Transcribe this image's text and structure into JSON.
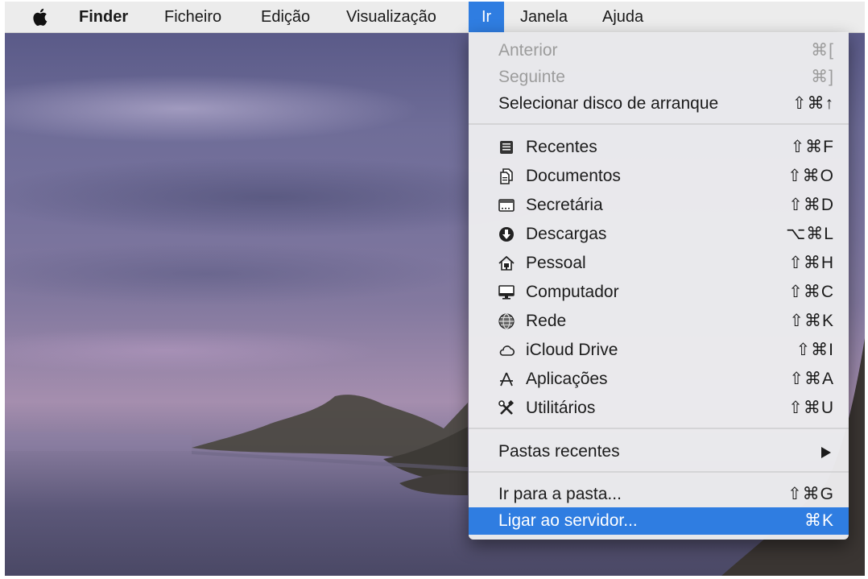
{
  "menubar": {
    "apple_icon": "apple-logo-icon",
    "app_name": "Finder",
    "items": [
      "Ficheiro",
      "Edição",
      "Visualização",
      "Ir",
      "Janela",
      "Ajuda"
    ],
    "active_item": "Ir"
  },
  "go_menu": {
    "navigation": [
      {
        "label": "Anterior",
        "shortcut": "⌘[",
        "enabled": false
      },
      {
        "label": "Seguinte",
        "shortcut": "⌘]",
        "enabled": false
      },
      {
        "label": "Selecionar disco de arranque",
        "shortcut": "⇧⌘↑",
        "enabled": true
      }
    ],
    "places": [
      {
        "label": "Recentes",
        "shortcut": "⇧⌘F",
        "icon": "recents-icon"
      },
      {
        "label": "Documentos",
        "shortcut": "⇧⌘O",
        "icon": "documents-icon"
      },
      {
        "label": "Secretária",
        "shortcut": "⇧⌘D",
        "icon": "desktop-icon"
      },
      {
        "label": "Descargas",
        "shortcut": "⌥⌘L",
        "icon": "downloads-icon"
      },
      {
        "label": "Pessoal",
        "shortcut": "⇧⌘H",
        "icon": "home-icon"
      },
      {
        "label": "Computador",
        "shortcut": "⇧⌘C",
        "icon": "computer-icon"
      },
      {
        "label": "Rede",
        "shortcut": "⇧⌘K",
        "icon": "network-icon"
      },
      {
        "label": "iCloud Drive",
        "shortcut": "⇧⌘I",
        "icon": "icloud-icon"
      },
      {
        "label": "Aplicações",
        "shortcut": "⇧⌘A",
        "icon": "applications-icon"
      },
      {
        "label": "Utilitários",
        "shortcut": "⇧⌘U",
        "icon": "utilities-icon"
      }
    ],
    "recent_folders": {
      "label": "Pastas recentes",
      "has_submenu": true
    },
    "folder_actions": [
      {
        "label": "Ir para a pasta...",
        "shortcut": "⇧⌘G",
        "selected": false
      },
      {
        "label": "Ligar ao servidor...",
        "shortcut": "⌘K",
        "selected": true
      }
    ]
  },
  "colors": {
    "selection_blue": "#2f7de1",
    "menubar_bg": "#ececec",
    "disabled_text": "#9c9c9c"
  }
}
